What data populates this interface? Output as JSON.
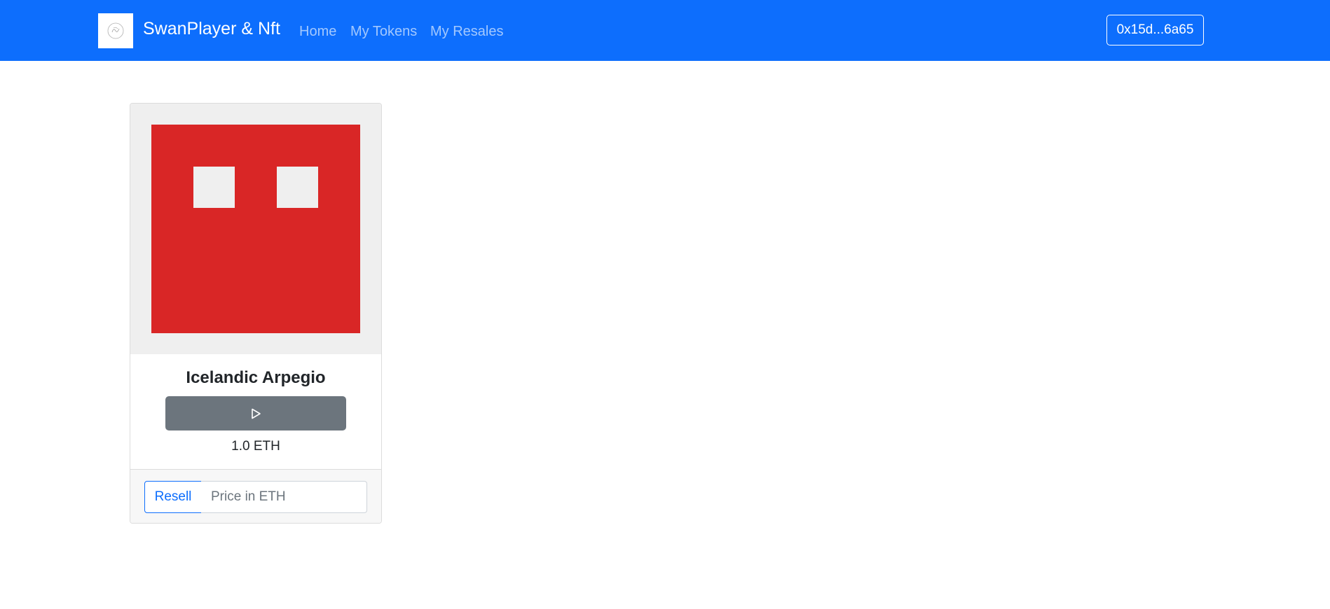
{
  "navbar": {
    "brand": "SwanPlayer & Nft",
    "links": [
      {
        "label": "Home"
      },
      {
        "label": "My Tokens"
      },
      {
        "label": "My Resales"
      }
    ],
    "wallet_address": "0x15d...6a65"
  },
  "nft_card": {
    "title": "Icelandic Arpegio",
    "price": "1.0 ETH",
    "image": {
      "background": "#d92626",
      "eyes": "#efefef"
    },
    "play_icon": "play-icon",
    "resell": {
      "button_label": "Resell",
      "placeholder": "Price in ETH",
      "value": ""
    }
  },
  "colors": {
    "primary": "#0d6efd",
    "secondary": "#6c757d"
  }
}
